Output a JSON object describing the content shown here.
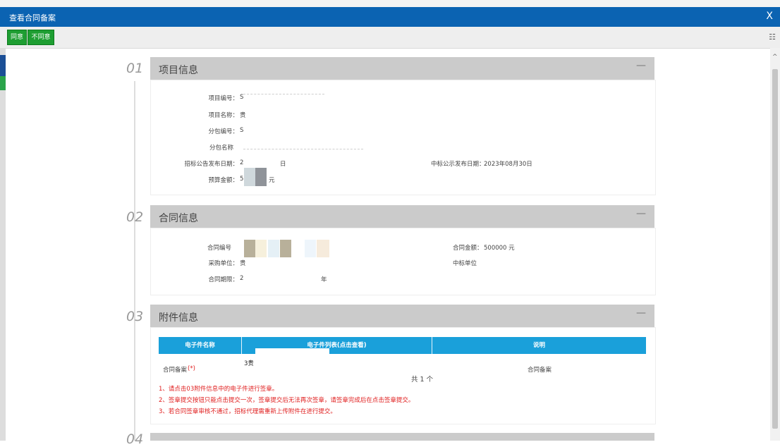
{
  "window": {
    "title": "查看合同备案",
    "close": "X"
  },
  "toolbar": {
    "agree_label": "同意",
    "disagree_label": "不同意"
  },
  "sections": {
    "s1": {
      "num": "01",
      "title": "项目信息",
      "collapse": "—",
      "fields": {
        "project_no_label": "项目编号：",
        "project_no_value": "S",
        "project_name_label": "项目名称：",
        "project_name_value": "贵",
        "pkg_no_label": "分包编号：",
        "pkg_no_value": "S",
        "pkg_name_label": "分包名称",
        "notice_date_label": "招标公告发布日期：",
        "notice_date_value": "2",
        "notice_date_tail": "日",
        "award_date_label": "中标公示发布日期：",
        "award_date_value": "2023年08月30日",
        "budget_label": "预算金额：",
        "budget_value": "5",
        "budget_unit": "元"
      }
    },
    "s2": {
      "num": "02",
      "title": "合同信息",
      "collapse": "—",
      "fields": {
        "contract_no_label": "合同编号",
        "contract_amount_label": "合同金额：",
        "contract_amount_value": "500000 元",
        "buyer_label": "采购单位：",
        "buyer_value": "贵",
        "winner_label": "中标单位",
        "period_label": "合同期限：",
        "period_value": "2",
        "period_tail": "年"
      }
    },
    "s3": {
      "num": "03",
      "title": "附件信息",
      "collapse": "—",
      "table": {
        "headers": [
          "电子件名称",
          "电子件列表(点击查看)",
          "说明"
        ],
        "row": {
          "name": "合同备案",
          "required": "(*)",
          "file": "3贵",
          "count": "共 1 个",
          "desc": "合同备案"
        }
      },
      "notes": [
        "1、请点击03附件信息中的电子件进行签章。",
        "2、签章提交按钮只能点击提交一次，签章提交后无法再次签章，请签章完成后在点击签章提交。",
        "3、若合同签章审核不通过，招标代理需重新上传附件在进行提交。"
      ]
    },
    "s4": {
      "num": "04"
    }
  }
}
